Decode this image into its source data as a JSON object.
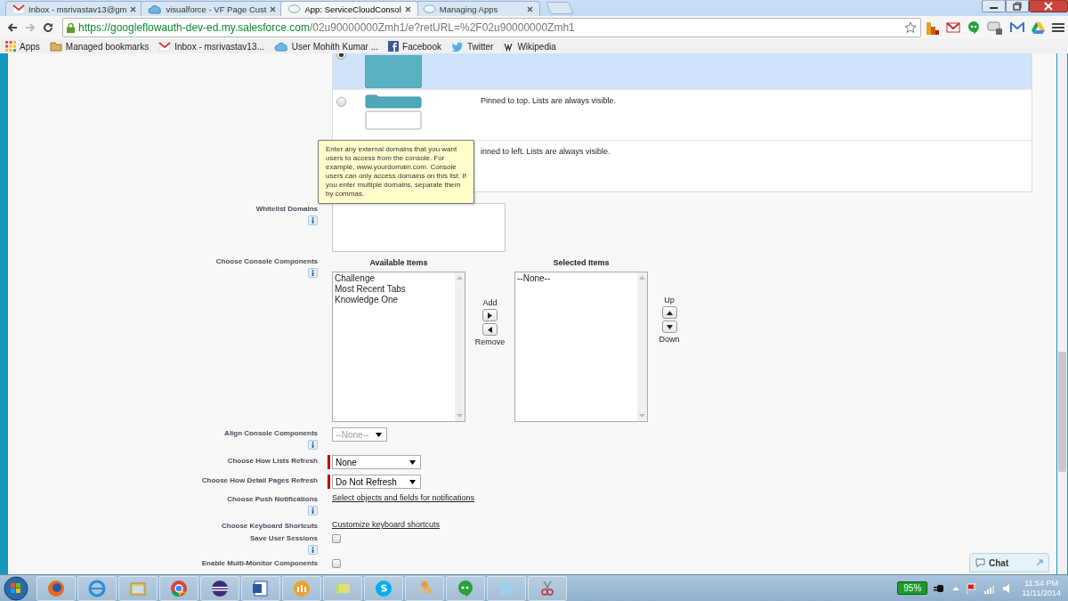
{
  "browser": {
    "tabs": [
      {
        "title": "Inbox - msrivastav13@gm",
        "selected": false,
        "kind": "mail"
      },
      {
        "title": "visualforce - VF Page Cust",
        "selected": false,
        "kind": "cloud"
      },
      {
        "title": "App: ServiceCloudConsol",
        "selected": true,
        "kind": "bubble"
      },
      {
        "title": "Managing Apps",
        "selected": false,
        "kind": "bubble"
      }
    ],
    "address": {
      "host": "https://googleflowauth-dev-ed.my.salesforce.com",
      "path": "/02u90000000Zmh1/e?retURL=%2F02u90000000Zmh1"
    },
    "bookmarks": [
      {
        "label": "Apps",
        "kind": "apps"
      },
      {
        "label": "Managed bookmarks",
        "kind": "folder"
      },
      {
        "label": "Inbox - msrivastav13...",
        "kind": "mail"
      },
      {
        "label": "User Mohith Kumar ...",
        "kind": "cloud"
      },
      {
        "label": "Facebook",
        "kind": "facebook"
      },
      {
        "label": "Twitter",
        "kind": "bird"
      },
      {
        "label": "Wikipedia",
        "kind": "wiki"
      }
    ]
  },
  "layout_options": [
    {
      "kind": "full",
      "selected": true
    },
    {
      "kind": "top",
      "selected": false,
      "description": "Pinned to top. Lists are always visible."
    },
    {
      "kind": "left",
      "selected": false,
      "description": "inned to left. Lists are always visible."
    }
  ],
  "tooltip": "Enter any external domains that you want users to access from the console. For example, www.yourdomain.com. Console users can only access domains on this list. If you enter multiple domains, separate them by commas.",
  "form": [
    {
      "kind": "textarea",
      "label": "Whitelist Domains",
      "info": true
    },
    {
      "kind": "duallist",
      "label": "Choose Console Components",
      "info": true,
      "available_title": "Available Items",
      "available": [
        "Challenge",
        "Most Recent Tabs",
        "Knowledge One"
      ],
      "selected_title": "Selected Items",
      "selected_items": [
        "--None--"
      ],
      "add": "Add",
      "remove": "Remove",
      "up": "Up",
      "down": "Down"
    },
    {
      "kind": "select",
      "label": "Align Console Components",
      "info": true,
      "value": "--None--",
      "required": false,
      "disabled": true
    },
    {
      "kind": "select",
      "label": "Choose How Lists Refresh",
      "info": false,
      "value": "None",
      "required": true,
      "disabled": false
    },
    {
      "kind": "select",
      "label": "Choose How Detail Pages Refresh",
      "info": false,
      "value": "Do Not Refresh",
      "required": true,
      "disabled": false
    },
    {
      "kind": "link",
      "label": "Choose Push Notifications",
      "info": true,
      "link": "Select objects and fields for notifications"
    },
    {
      "kind": "link",
      "label": "Choose Keyboard Shortcuts",
      "info": false,
      "link": "Customize keyboard shortcuts"
    },
    {
      "kind": "checkbox",
      "label": "Save User Sessions",
      "info": true,
      "checked": false
    },
    {
      "kind": "checkbox",
      "label": "Enable Multi-Monitor Components",
      "info": false,
      "checked": false
    }
  ],
  "chat": "Chat",
  "taskbar": {
    "battery": "95%",
    "time": "11:54 PM",
    "date": "11/11/2014"
  }
}
